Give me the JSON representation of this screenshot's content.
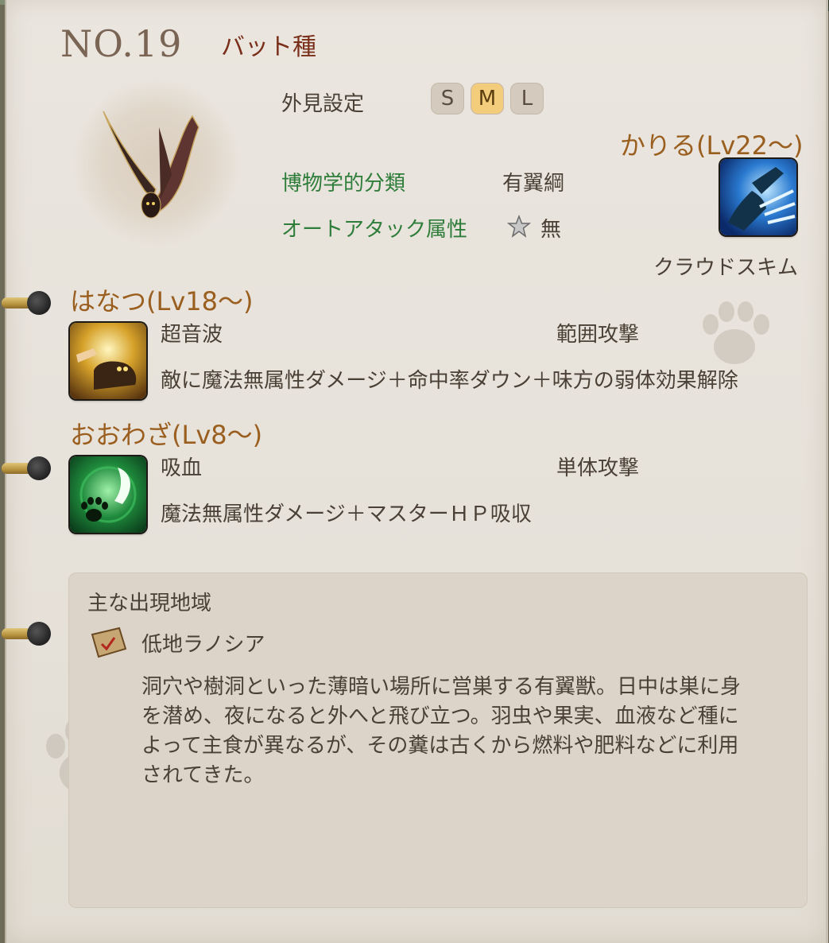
{
  "header": {
    "number": "NO.19",
    "name": "バット種"
  },
  "appearance": {
    "label": "外見設定",
    "sizes": [
      "S",
      "M",
      "L"
    ],
    "selected": "M"
  },
  "classification": {
    "label": "博物学的分類",
    "value": "有翼綱"
  },
  "auto_attack": {
    "label": "オートアタック属性",
    "value": "無"
  },
  "kariru": {
    "heading": "かりる(Lv22～)",
    "skill_name": "クラウドスキム"
  },
  "hanatsu": {
    "heading": "はなつ(Lv18～)",
    "skill_name": "超音波",
    "skill_type": "範囲攻撃",
    "skill_desc": "敵に魔法無属性ダメージ＋命中率ダウン＋味方の弱体効果解除"
  },
  "oowaza": {
    "heading": "おおわざ(Lv8～)",
    "skill_name": "吸血",
    "skill_type": "単体攻撃",
    "skill_desc": "魔法無属性ダメージ＋マスターＨＰ吸収"
  },
  "region": {
    "title": "主な出現地域",
    "name": "低地ラノシア",
    "description_lines": [
      "洞穴や樹洞といった薄暗い場所に営巣する有翼獣。日中は巣に身",
      "を潜め、夜になると外へと飛び立つ。羽虫や果実、血液など種に",
      "よって主食が異なるが、その糞は古くから燃料や肥料などに利用",
      "されてきた。"
    ]
  },
  "colors": {
    "accent_orange": "#9a5e1e",
    "accent_green": "#2f7d3a",
    "name_red": "#7a2f1a",
    "size_selected": "#f3cc7c"
  }
}
